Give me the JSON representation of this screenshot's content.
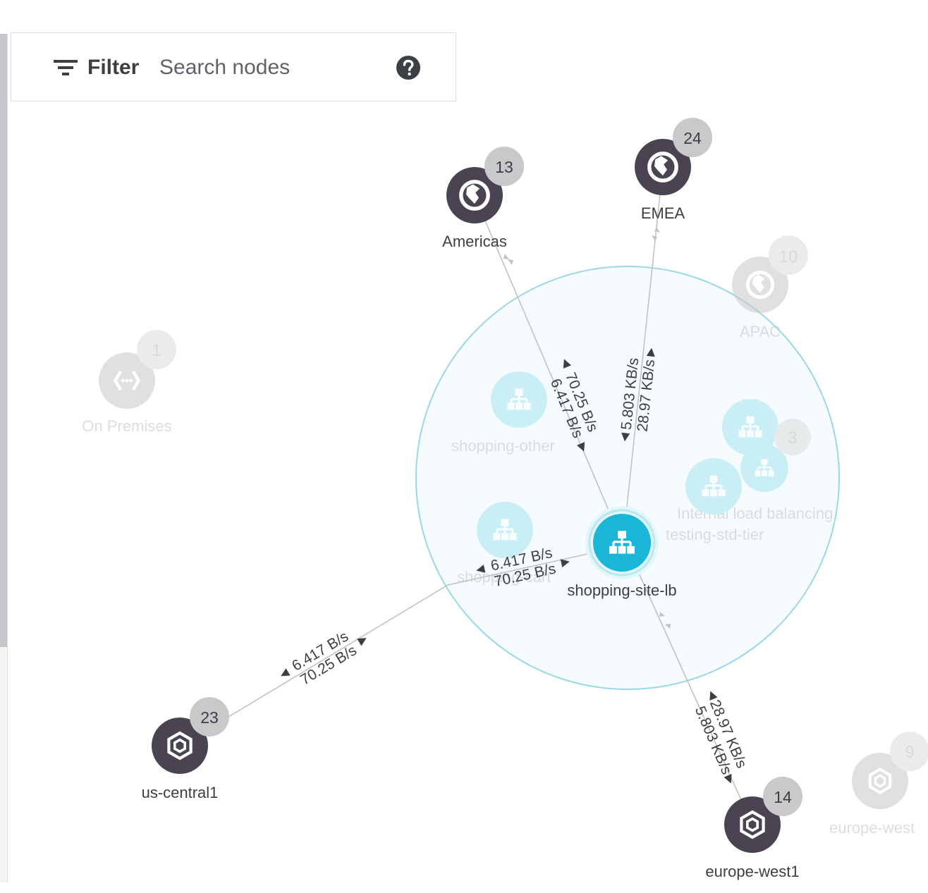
{
  "toolbar": {
    "filter_label": "Filter",
    "search_placeholder": "Search nodes",
    "help_icon": "help-circle-icon",
    "filter_icon": "filter-list-icon"
  },
  "colors": {
    "region_node": "#4a4452",
    "lb_node": "#1ab6d7",
    "faded_lb_node": "#a6e3ef",
    "faded_node": "#c7c7c7",
    "focus_ring": "#9ad8e6",
    "badge": "#c9c9cc",
    "edge": "#c2c2c2",
    "label": "#3c4043"
  },
  "nodes": {
    "americas": {
      "label": "Americas",
      "badge": "13",
      "icon": "globe-icon"
    },
    "emea": {
      "label": "EMEA",
      "badge": "24",
      "icon": "globe-icon"
    },
    "apac": {
      "label": "APAC",
      "badge": "10",
      "icon": "globe-icon"
    },
    "on_premises": {
      "label": "On Premises",
      "badge": "1",
      "icon": "vpn-link-icon"
    },
    "shopping_site_lb": {
      "label": "shopping-site-lb",
      "icon": "load-balancer-icon"
    },
    "shopping_other": {
      "label": "shopping-other",
      "icon": "load-balancer-icon"
    },
    "shopping_cart": {
      "label": "shopping-cart",
      "icon": "load-balancer-icon"
    },
    "internal_lb": {
      "label": "Internal load balancing",
      "badge": "3",
      "icon": "load-balancer-icon"
    },
    "testing_std_tier": {
      "label": "testing-std-tier",
      "icon": "load-balancer-icon"
    },
    "us_central1": {
      "label": "us-central1",
      "badge": "23",
      "icon": "gcp-region-icon"
    },
    "europe_west1": {
      "label": "europe-west1",
      "badge": "14",
      "icon": "gcp-region-icon"
    },
    "europe_west2": {
      "label": "europe-west",
      "badge": "9",
      "icon": "gcp-region-icon"
    }
  },
  "edges": {
    "americas": {
      "rate_a": "70.25 B/s",
      "rate_b": "6.417 B/s"
    },
    "emea": {
      "rate_a": "5.803 KB/s",
      "rate_b": "28.97 KB/s"
    },
    "us_central1_near": {
      "rate_a": "6.417 B/s",
      "rate_b": "70.25 B/s"
    },
    "us_central1_far": {
      "rate_a": "6.417 B/s",
      "rate_b": "70.25 B/s"
    },
    "europe_west1": {
      "rate_a": "28.97 KB/s",
      "rate_b": "5.803 KB/s"
    }
  }
}
